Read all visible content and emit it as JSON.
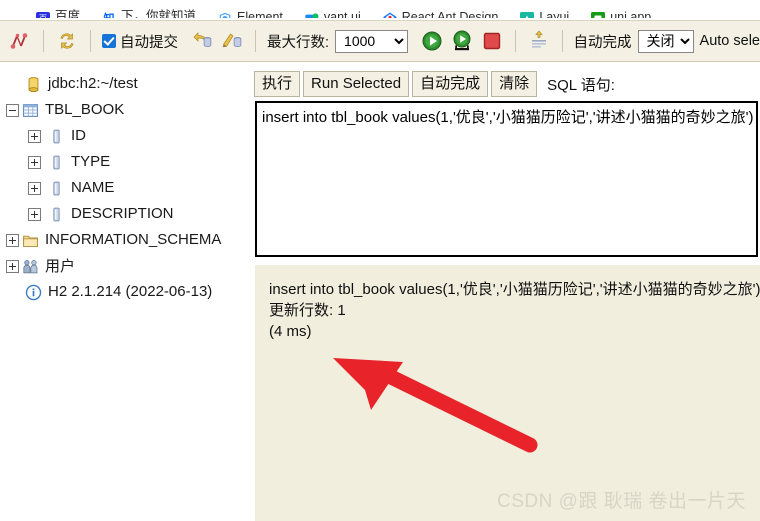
{
  "bookmark_bar": {
    "items": [
      {
        "label": "百度",
        "icon": "baidu-favicon"
      },
      {
        "label": "下，你就知道",
        "icon": "zhihu-favicon"
      },
      {
        "label": "Element",
        "icon": "element-shield-favicon"
      },
      {
        "label": "vant ui",
        "icon": "vant-chat-favicon"
      },
      {
        "label": "React Ant Design",
        "icon": "ant-design-favicon"
      },
      {
        "label": "Layui",
        "icon": "layui-favicon"
      },
      {
        "label": "uni app",
        "icon": "uniapp-favicon"
      }
    ]
  },
  "toolbar": {
    "disconnect_icon": "disconnect-icon",
    "refresh_icon": "refresh-icon",
    "autocommit_label": "自动提交",
    "autocommit_checked": true,
    "rollback_icon": "rollback-icon",
    "commit_icon": "commit-icon",
    "maxrows_label": "最大行数:",
    "maxrows_value": "1000",
    "maxrows_options": [
      "1000"
    ],
    "run_icon": "run-icon",
    "run_selected_icon": "run-selected-icon",
    "stop_icon": "stop-icon",
    "clear_icon": "clear-icon",
    "autocomplete_label": "自动完成",
    "autocomplete_value": "关闭",
    "autocomplete_options": [
      "关闭"
    ],
    "auto_select_label": "Auto sele"
  },
  "tree": {
    "items": [
      {
        "label": "jdbc:h2:~/test",
        "icon": "database-icon",
        "expander": "none",
        "indent": 0
      },
      {
        "label": "TBL_BOOK",
        "icon": "table-icon",
        "expander": "minus",
        "indent": 1
      },
      {
        "label": "ID",
        "icon": "column-icon",
        "expander": "plus",
        "indent": 2
      },
      {
        "label": "TYPE",
        "icon": "column-icon",
        "expander": "plus",
        "indent": 2
      },
      {
        "label": "NAME",
        "icon": "column-icon",
        "expander": "plus",
        "indent": 2
      },
      {
        "label": "DESCRIPTION",
        "icon": "column-icon",
        "expander": "plus",
        "indent": 2
      },
      {
        "label": "INFORMATION_SCHEMA",
        "icon": "folder-icon",
        "expander": "plus",
        "indent": 1
      },
      {
        "label": "用户",
        "icon": "users-icon",
        "expander": "plus",
        "indent": 1
      },
      {
        "label": "H2 2.1.214 (2022-06-13)",
        "icon": "info-icon",
        "expander": "none",
        "indent": 0
      }
    ]
  },
  "editor": {
    "run_button": "执行",
    "run_selected_button": "Run Selected",
    "autocomplete_button": "自动完成",
    "clear_button": "清除",
    "sql_caption": "SQL 语句:",
    "sql_value": "insert into tbl_book values(1,'优良','小猫猫历险记','讲述小猫猫的奇妙之旅')",
    "sql_placeholder": ""
  },
  "result": {
    "lines": [
      "insert into tbl_book values(1,'优良','小猫猫历险记','讲述小猫猫的奇妙之旅')",
      "更新行数: 1",
      "(4 ms)"
    ],
    "echoed_sql": "insert into tbl_book values(1,'优良','小猫猫历险记','讲述小猫猫的奇妙之旅')",
    "update_count": "更新行数: 1",
    "elapsed": "(4 ms)"
  },
  "annotation": {
    "arrow_color": "#e8242a",
    "arrow_name": "red-pointer-arrow"
  },
  "watermark": {
    "text": "CSDN @跟 耿瑞 卷出一片天"
  },
  "colors": {
    "toolbar_bg": "#f4f1e4",
    "result_bg": "#f1eede",
    "accent_blue": "#1673d8",
    "arrow_red": "#e8242a"
  }
}
